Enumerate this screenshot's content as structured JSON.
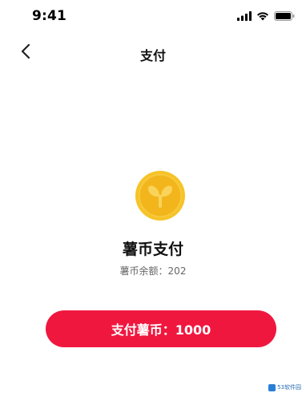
{
  "status_bar": {
    "time": "9:41",
    "icons": [
      "cellular-signal-icon",
      "wifi-icon",
      "battery-icon"
    ]
  },
  "nav": {
    "back_icon": "chevron-left-icon",
    "title": "支付"
  },
  "coin": {
    "icon": "coin-icon",
    "colors": {
      "outer": "#f6c328",
      "inner": "#f3b51c",
      "mark": "#f9d35a"
    }
  },
  "payment": {
    "title": "薯币支付",
    "balance_label": "薯币余额：",
    "balance_value": "202"
  },
  "pay_button": {
    "label": "支付薯币：1000",
    "color": "#f0173f"
  },
  "watermark": {
    "text": "53软件园"
  }
}
